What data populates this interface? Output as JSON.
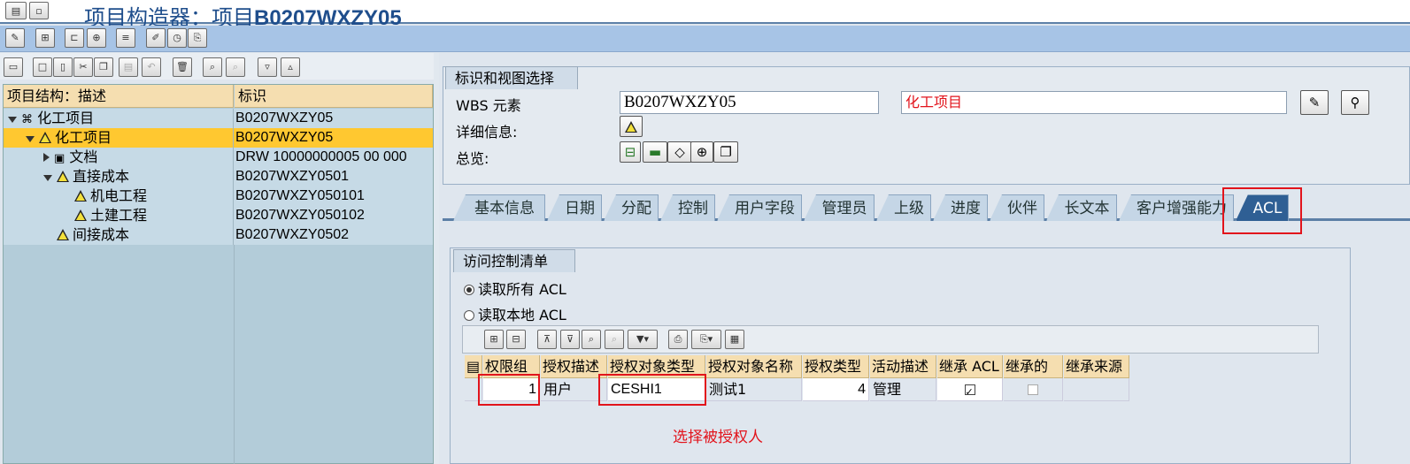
{
  "window": {
    "title": "项目构造器：项目B0207WXZY05",
    "title_prefix": "项目构造器：项目",
    "title_id": "B0207WXZY05"
  },
  "tree": {
    "col_desc": "项目结构：描述",
    "col_id": "标识",
    "rows": [
      {
        "label": "化工项目",
        "id": "B0207WXZY05"
      },
      {
        "label": "化工项目",
        "id": "B0207WXZY05"
      },
      {
        "label": "文档",
        "id": "DRW 10000000005 00 000"
      },
      {
        "label": "直接成本",
        "id": "B0207WXZY0501"
      },
      {
        "label": "机电工程",
        "id": "B0207WXZY050101"
      },
      {
        "label": "土建工程",
        "id": "B0207WXZY050102"
      },
      {
        "label": "间接成本",
        "id": "B0207WXZY0502"
      }
    ]
  },
  "ident": {
    "header": "标识和视图选择",
    "wbs_label": "WBS 元素",
    "wbs_value": "B0207WXZY05",
    "wbs_desc": "化工项目",
    "detail_label": "详细信息:",
    "overview_label": "总览:"
  },
  "tabs": [
    "基本信息",
    "日期",
    "分配",
    "控制",
    "用户字段",
    "管理员",
    "上级",
    "进度",
    "伙伴",
    "长文本",
    "客户增强能力",
    "ACL"
  ],
  "acl": {
    "header": "访问控制清单",
    "radio_all": "读取所有 ACL",
    "radio_local": "读取本地 ACL",
    "columns": [
      "权限组",
      "授权描述",
      "授权对象类型",
      "授权对象名称",
      "授权类型",
      "活动描述",
      "继承 ACL",
      "继承的",
      "继承来源"
    ],
    "row": {
      "group": "1",
      "auth_desc": "用户",
      "obj_type": "CESHI1",
      "obj_name": "测试1",
      "auth_type": "4",
      "activity": "管理"
    },
    "annotation": "选择被授权人"
  },
  "colors": {
    "accent": "#2f5f94",
    "highlight": "#e2141c",
    "header_bg": "#f5deb0",
    "selected_row": "#ffc830"
  }
}
